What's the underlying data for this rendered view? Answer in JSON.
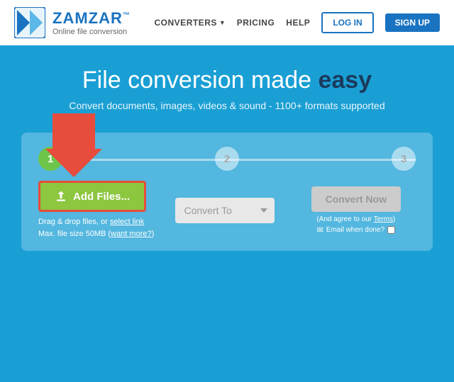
{
  "header": {
    "logo_name": "ZAMZAR",
    "logo_tm": "™",
    "logo_tagline": "Online file conversion",
    "nav": {
      "converters_label": "CONVERTERS",
      "pricing_label": "PRICING",
      "help_label": "HELP",
      "login_label": "LOG IN",
      "signup_label": "SIGN UP"
    }
  },
  "hero": {
    "title_part1": "File ",
    "title_part2": "conversion",
    "title_part3": " made ",
    "title_highlight": "easy",
    "subtitle": "Convert documents, images, videos & sound - 1100+ formats supported"
  },
  "converter": {
    "steps": [
      {
        "number": "1",
        "active": true
      },
      {
        "number": "2",
        "active": false
      },
      {
        "number": "3",
        "active": false
      }
    ],
    "add_files_label": "Add Files...",
    "drag_hint": "Drag & drop files, or",
    "select_link": "select link",
    "max_size": "Max. file size 50MB",
    "want_more_link": "want more?",
    "convert_to_placeholder": "Convert To",
    "convert_now_label": "Convert Now",
    "agree_text": "(And agree to our",
    "terms_link": "Terms",
    "agree_close": ")",
    "email_label": "Email when done?",
    "colors": {
      "background": "#1a9fd4",
      "btn_add": "#8dc63f",
      "btn_convert": "#cccccc",
      "step_active": "#6dc54a",
      "step_inactive": "rgba(255,255,255,0.5)"
    }
  }
}
